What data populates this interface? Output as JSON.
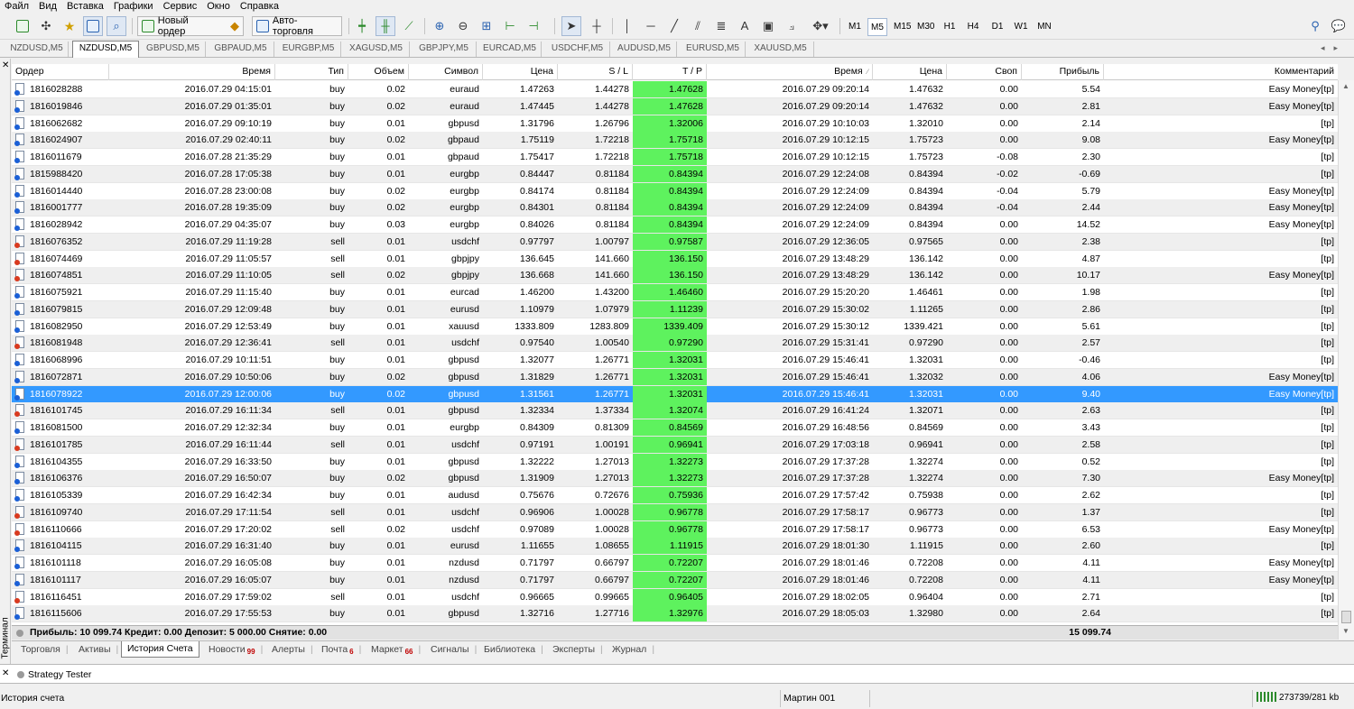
{
  "menu": [
    "Файл",
    "Вид",
    "Вставка",
    "Графики",
    "Сервис",
    "Окно",
    "Справка"
  ],
  "toolbar": {
    "new_order_label": "Новый ордер",
    "autotrading_label": "Авто-торговля",
    "timeframes": [
      "M1",
      "M5",
      "M15",
      "M30",
      "H1",
      "H4",
      "D1",
      "W1",
      "MN"
    ],
    "active_timeframe": "M5"
  },
  "chart_tabs": [
    "NZDUSD,M5",
    "NZDUSD,M5",
    "GBPUSD,M5",
    "GBPAUD,M5",
    "EURGBP,M5",
    "XAGUSD,M5",
    "GBPJPY,M5",
    "EURCAD,M5",
    "USDCHF,M5",
    "AUDUSD,M5",
    "EURUSD,M5",
    "XAUUSD,M5"
  ],
  "active_chart_tab": 1,
  "terminal_label": "Терминал",
  "columns": {
    "order": "Ордер",
    "open_time": "Время",
    "type": "Тип",
    "volume": "Объем",
    "symbol": "Символ",
    "open_price": "Цена",
    "sl": "S / L",
    "tp": "T / P",
    "close_time": "Время",
    "close_price": "Цена",
    "swap": "Своп",
    "profit": "Прибыль",
    "comment": "Комментарий"
  },
  "rows": [
    {
      "order": "1816028288",
      "open_time": "2016.07.29 04:15:01",
      "type": "buy",
      "volume": "0.02",
      "symbol": "euraud",
      "open_price": "1.47263",
      "sl": "1.44278",
      "tp": "1.47628",
      "close_time": "2016.07.29 09:20:14",
      "close_price": "1.47632",
      "swap": "0.00",
      "profit": "5.54",
      "comment": "Easy Money[tp]"
    },
    {
      "order": "1816019846",
      "open_time": "2016.07.29 01:35:01",
      "type": "buy",
      "volume": "0.02",
      "symbol": "euraud",
      "open_price": "1.47445",
      "sl": "1.44278",
      "tp": "1.47628",
      "close_time": "2016.07.29 09:20:14",
      "close_price": "1.47632",
      "swap": "0.00",
      "profit": "2.81",
      "comment": "Easy Money[tp]"
    },
    {
      "order": "1816062682",
      "open_time": "2016.07.29 09:10:19",
      "type": "buy",
      "volume": "0.01",
      "symbol": "gbpusd",
      "open_price": "1.31796",
      "sl": "1.26796",
      "tp": "1.32006",
      "close_time": "2016.07.29 10:10:03",
      "close_price": "1.32010",
      "swap": "0.00",
      "profit": "2.14",
      "comment": "[tp]"
    },
    {
      "order": "1816024907",
      "open_time": "2016.07.29 02:40:11",
      "type": "buy",
      "volume": "0.02",
      "symbol": "gbpaud",
      "open_price": "1.75119",
      "sl": "1.72218",
      "tp": "1.75718",
      "close_time": "2016.07.29 10:12:15",
      "close_price": "1.75723",
      "swap": "0.00",
      "profit": "9.08",
      "comment": "Easy Money[tp]"
    },
    {
      "order": "1816011679",
      "open_time": "2016.07.28 21:35:29",
      "type": "buy",
      "volume": "0.01",
      "symbol": "gbpaud",
      "open_price": "1.75417",
      "sl": "1.72218",
      "tp": "1.75718",
      "close_time": "2016.07.29 10:12:15",
      "close_price": "1.75723",
      "swap": "-0.08",
      "profit": "2.30",
      "comment": "[tp]"
    },
    {
      "order": "1815988420",
      "open_time": "2016.07.28 17:05:38",
      "type": "buy",
      "volume": "0.01",
      "symbol": "eurgbp",
      "open_price": "0.84447",
      "sl": "0.81184",
      "tp": "0.84394",
      "close_time": "2016.07.29 12:24:08",
      "close_price": "0.84394",
      "swap": "-0.02",
      "profit": "-0.69",
      "comment": "[tp]"
    },
    {
      "order": "1816014440",
      "open_time": "2016.07.28 23:00:08",
      "type": "buy",
      "volume": "0.02",
      "symbol": "eurgbp",
      "open_price": "0.84174",
      "sl": "0.81184",
      "tp": "0.84394",
      "close_time": "2016.07.29 12:24:09",
      "close_price": "0.84394",
      "swap": "-0.04",
      "profit": "5.79",
      "comment": "Easy Money[tp]"
    },
    {
      "order": "1816001777",
      "open_time": "2016.07.28 19:35:09",
      "type": "buy",
      "volume": "0.02",
      "symbol": "eurgbp",
      "open_price": "0.84301",
      "sl": "0.81184",
      "tp": "0.84394",
      "close_time": "2016.07.29 12:24:09",
      "close_price": "0.84394",
      "swap": "-0.04",
      "profit": "2.44",
      "comment": "Easy Money[tp]"
    },
    {
      "order": "1816028942",
      "open_time": "2016.07.29 04:35:07",
      "type": "buy",
      "volume": "0.03",
      "symbol": "eurgbp",
      "open_price": "0.84026",
      "sl": "0.81184",
      "tp": "0.84394",
      "close_time": "2016.07.29 12:24:09",
      "close_price": "0.84394",
      "swap": "0.00",
      "profit": "14.52",
      "comment": "Easy Money[tp]"
    },
    {
      "order": "1816076352",
      "open_time": "2016.07.29 11:19:28",
      "type": "sell",
      "volume": "0.01",
      "symbol": "usdchf",
      "open_price": "0.97797",
      "sl": "1.00797",
      "tp": "0.97587",
      "close_time": "2016.07.29 12:36:05",
      "close_price": "0.97565",
      "swap": "0.00",
      "profit": "2.38",
      "comment": "[tp]"
    },
    {
      "order": "1816074469",
      "open_time": "2016.07.29 11:05:57",
      "type": "sell",
      "volume": "0.01",
      "symbol": "gbpjpy",
      "open_price": "136.645",
      "sl": "141.660",
      "tp": "136.150",
      "close_time": "2016.07.29 13:48:29",
      "close_price": "136.142",
      "swap": "0.00",
      "profit": "4.87",
      "comment": "[tp]"
    },
    {
      "order": "1816074851",
      "open_time": "2016.07.29 11:10:05",
      "type": "sell",
      "volume": "0.02",
      "symbol": "gbpjpy",
      "open_price": "136.668",
      "sl": "141.660",
      "tp": "136.150",
      "close_time": "2016.07.29 13:48:29",
      "close_price": "136.142",
      "swap": "0.00",
      "profit": "10.17",
      "comment": "Easy Money[tp]"
    },
    {
      "order": "1816075921",
      "open_time": "2016.07.29 11:15:40",
      "type": "buy",
      "volume": "0.01",
      "symbol": "eurcad",
      "open_price": "1.46200",
      "sl": "1.43200",
      "tp": "1.46460",
      "close_time": "2016.07.29 15:20:20",
      "close_price": "1.46461",
      "swap": "0.00",
      "profit": "1.98",
      "comment": "[tp]"
    },
    {
      "order": "1816079815",
      "open_time": "2016.07.29 12:09:48",
      "type": "buy",
      "volume": "0.01",
      "symbol": "eurusd",
      "open_price": "1.10979",
      "sl": "1.07979",
      "tp": "1.11239",
      "close_time": "2016.07.29 15:30:02",
      "close_price": "1.11265",
      "swap": "0.00",
      "profit": "2.86",
      "comment": "[tp]"
    },
    {
      "order": "1816082950",
      "open_time": "2016.07.29 12:53:49",
      "type": "buy",
      "volume": "0.01",
      "symbol": "xauusd",
      "open_price": "1333.809",
      "sl": "1283.809",
      "tp": "1339.409",
      "close_time": "2016.07.29 15:30:12",
      "close_price": "1339.421",
      "swap": "0.00",
      "profit": "5.61",
      "comment": "[tp]"
    },
    {
      "order": "1816081948",
      "open_time": "2016.07.29 12:36:41",
      "type": "sell",
      "volume": "0.01",
      "symbol": "usdchf",
      "open_price": "0.97540",
      "sl": "1.00540",
      "tp": "0.97290",
      "close_time": "2016.07.29 15:31:41",
      "close_price": "0.97290",
      "swap": "0.00",
      "profit": "2.57",
      "comment": "[tp]"
    },
    {
      "order": "1816068996",
      "open_time": "2016.07.29 10:11:51",
      "type": "buy",
      "volume": "0.01",
      "symbol": "gbpusd",
      "open_price": "1.32077",
      "sl": "1.26771",
      "tp": "1.32031",
      "close_time": "2016.07.29 15:46:41",
      "close_price": "1.32031",
      "swap": "0.00",
      "profit": "-0.46",
      "comment": "[tp]"
    },
    {
      "order": "1816072871",
      "open_time": "2016.07.29 10:50:06",
      "type": "buy",
      "volume": "0.02",
      "symbol": "gbpusd",
      "open_price": "1.31829",
      "sl": "1.26771",
      "tp": "1.32031",
      "close_time": "2016.07.29 15:46:41",
      "close_price": "1.32032",
      "swap": "0.00",
      "profit": "4.06",
      "comment": "Easy Money[tp]"
    },
    {
      "order": "1816078922",
      "open_time": "2016.07.29 12:00:06",
      "type": "buy",
      "volume": "0.02",
      "symbol": "gbpusd",
      "open_price": "1.31561",
      "sl": "1.26771",
      "tp": "1.32031",
      "close_time": "2016.07.29 15:46:41",
      "close_price": "1.32031",
      "swap": "0.00",
      "profit": "9.40",
      "comment": "Easy Money[tp]",
      "selected": true
    },
    {
      "order": "1816101745",
      "open_time": "2016.07.29 16:11:34",
      "type": "sell",
      "volume": "0.01",
      "symbol": "gbpusd",
      "open_price": "1.32334",
      "sl": "1.37334",
      "tp": "1.32074",
      "close_time": "2016.07.29 16:41:24",
      "close_price": "1.32071",
      "swap": "0.00",
      "profit": "2.63",
      "comment": "[tp]"
    },
    {
      "order": "1816081500",
      "open_time": "2016.07.29 12:32:34",
      "type": "buy",
      "volume": "0.01",
      "symbol": "eurgbp",
      "open_price": "0.84309",
      "sl": "0.81309",
      "tp": "0.84569",
      "close_time": "2016.07.29 16:48:56",
      "close_price": "0.84569",
      "swap": "0.00",
      "profit": "3.43",
      "comment": "[tp]"
    },
    {
      "order": "1816101785",
      "open_time": "2016.07.29 16:11:44",
      "type": "sell",
      "volume": "0.01",
      "symbol": "usdchf",
      "open_price": "0.97191",
      "sl": "1.00191",
      "tp": "0.96941",
      "close_time": "2016.07.29 17:03:18",
      "close_price": "0.96941",
      "swap": "0.00",
      "profit": "2.58",
      "comment": "[tp]"
    },
    {
      "order": "1816104355",
      "open_time": "2016.07.29 16:33:50",
      "type": "buy",
      "volume": "0.01",
      "symbol": "gbpusd",
      "open_price": "1.32222",
      "sl": "1.27013",
      "tp": "1.32273",
      "close_time": "2016.07.29 17:37:28",
      "close_price": "1.32274",
      "swap": "0.00",
      "profit": "0.52",
      "comment": "[tp]"
    },
    {
      "order": "1816106376",
      "open_time": "2016.07.29 16:50:07",
      "type": "buy",
      "volume": "0.02",
      "symbol": "gbpusd",
      "open_price": "1.31909",
      "sl": "1.27013",
      "tp": "1.32273",
      "close_time": "2016.07.29 17:37:28",
      "close_price": "1.32274",
      "swap": "0.00",
      "profit": "7.30",
      "comment": "Easy Money[tp]"
    },
    {
      "order": "1816105339",
      "open_time": "2016.07.29 16:42:34",
      "type": "buy",
      "volume": "0.01",
      "symbol": "audusd",
      "open_price": "0.75676",
      "sl": "0.72676",
      "tp": "0.75936",
      "close_time": "2016.07.29 17:57:42",
      "close_price": "0.75938",
      "swap": "0.00",
      "profit": "2.62",
      "comment": "[tp]"
    },
    {
      "order": "1816109740",
      "open_time": "2016.07.29 17:11:54",
      "type": "sell",
      "volume": "0.01",
      "symbol": "usdchf",
      "open_price": "0.96906",
      "sl": "1.00028",
      "tp": "0.96778",
      "close_time": "2016.07.29 17:58:17",
      "close_price": "0.96773",
      "swap": "0.00",
      "profit": "1.37",
      "comment": "[tp]"
    },
    {
      "order": "1816110666",
      "open_time": "2016.07.29 17:20:02",
      "type": "sell",
      "volume": "0.02",
      "symbol": "usdchf",
      "open_price": "0.97089",
      "sl": "1.00028",
      "tp": "0.96778",
      "close_time": "2016.07.29 17:58:17",
      "close_price": "0.96773",
      "swap": "0.00",
      "profit": "6.53",
      "comment": "Easy Money[tp]"
    },
    {
      "order": "1816104115",
      "open_time": "2016.07.29 16:31:40",
      "type": "buy",
      "volume": "0.01",
      "symbol": "eurusd",
      "open_price": "1.11655",
      "sl": "1.08655",
      "tp": "1.11915",
      "close_time": "2016.07.29 18:01:30",
      "close_price": "1.11915",
      "swap": "0.00",
      "profit": "2.60",
      "comment": "[tp]"
    },
    {
      "order": "1816101118",
      "open_time": "2016.07.29 16:05:08",
      "type": "buy",
      "volume": "0.01",
      "symbol": "nzdusd",
      "open_price": "0.71797",
      "sl": "0.66797",
      "tp": "0.72207",
      "close_time": "2016.07.29 18:01:46",
      "close_price": "0.72208",
      "swap": "0.00",
      "profit": "4.11",
      "comment": "Easy Money[tp]"
    },
    {
      "order": "1816101117",
      "open_time": "2016.07.29 16:05:07",
      "type": "buy",
      "volume": "0.01",
      "symbol": "nzdusd",
      "open_price": "0.71797",
      "sl": "0.66797",
      "tp": "0.72207",
      "close_time": "2016.07.29 18:01:46",
      "close_price": "0.72208",
      "swap": "0.00",
      "profit": "4.11",
      "comment": "Easy Money[tp]"
    },
    {
      "order": "1816116451",
      "open_time": "2016.07.29 17:59:02",
      "type": "sell",
      "volume": "0.01",
      "symbol": "usdchf",
      "open_price": "0.96665",
      "sl": "0.99665",
      "tp": "0.96405",
      "close_time": "2016.07.29 18:02:05",
      "close_price": "0.96404",
      "swap": "0.00",
      "profit": "2.71",
      "comment": "[tp]"
    },
    {
      "order": "1816115606",
      "open_time": "2016.07.29 17:55:53",
      "type": "buy",
      "volume": "0.01",
      "symbol": "gbpusd",
      "open_price": "1.32716",
      "sl": "1.27716",
      "tp": "1.32976",
      "close_time": "2016.07.29 18:05:03",
      "close_price": "1.32980",
      "swap": "0.00",
      "profit": "2.64",
      "comment": "[tp]"
    }
  ],
  "summary": {
    "text": "Прибыль: 10 099.74  Кредит: 0.00  Депозит: 5 000.00  Снятие: 0.00",
    "total_profit": "15 099.74"
  },
  "bottom_tabs": [
    {
      "label": "Торговля",
      "count": ""
    },
    {
      "label": "Активы",
      "count": ""
    },
    {
      "label": "История Счета",
      "count": "",
      "active": true
    },
    {
      "label": "Новости",
      "count": "99"
    },
    {
      "label": "Алерты",
      "count": ""
    },
    {
      "label": "Почта",
      "count": "6"
    },
    {
      "label": "Маркет",
      "count": "66"
    },
    {
      "label": "Сигналы",
      "count": ""
    },
    {
      "label": "Библиотека",
      "count": ""
    },
    {
      "label": "Эксперты",
      "count": ""
    },
    {
      "label": "Журнал",
      "count": ""
    }
  ],
  "strategy_tester_label": "Strategy Tester",
  "status": {
    "left": "История счета",
    "profile": "Мартин 001",
    "traffic": "273739/281 kb"
  },
  "colors": {
    "tp_highlight": "#5ef25e",
    "selection": "#3399ff",
    "buy_marker": "#1a5fd6",
    "sell_marker": "#d93a1f"
  }
}
